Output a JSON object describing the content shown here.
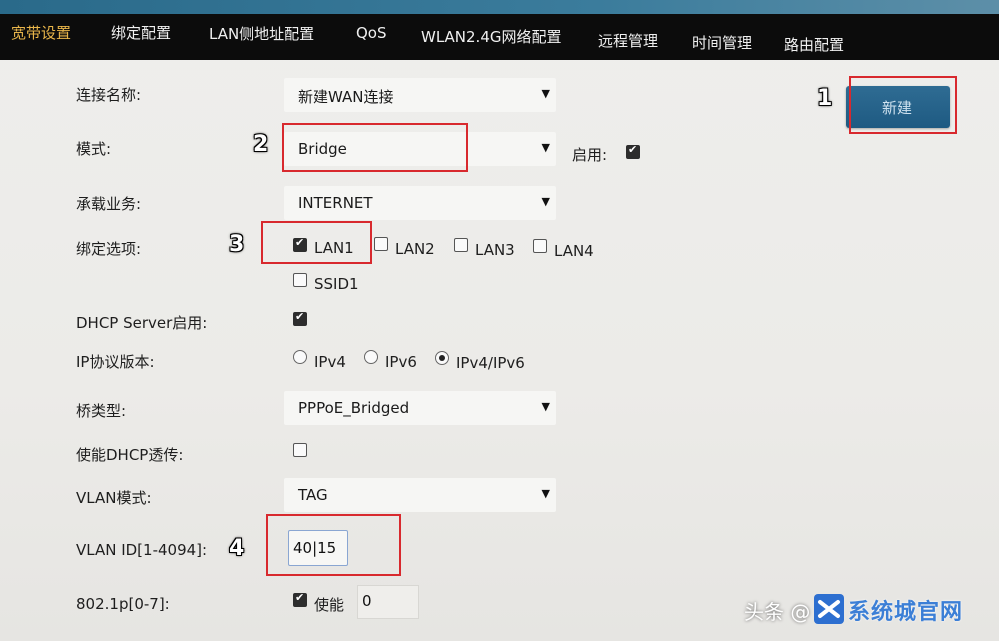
{
  "nav": {
    "items": [
      {
        "label": "宽带设置",
        "active": true
      },
      {
        "label": "绑定配置"
      },
      {
        "label": "LAN侧地址配置"
      },
      {
        "label": "QoS"
      },
      {
        "label": "WLAN2.4G网络配置"
      },
      {
        "label": "远程管理"
      },
      {
        "label": "时间管理"
      },
      {
        "label": "路由配置"
      }
    ]
  },
  "new_button": {
    "label": "新建"
  },
  "form": {
    "connection_name": {
      "label": "连接名称:",
      "value": "新建WAN连接"
    },
    "mode": {
      "label": "模式:",
      "value": "Bridge",
      "enable_label": "启用:",
      "enable_checked": true
    },
    "service": {
      "label": "承载业务:",
      "value": "INTERNET"
    },
    "binding": {
      "label": "绑定选项:",
      "options": [
        {
          "label": "LAN1",
          "checked": true
        },
        {
          "label": "LAN2",
          "checked": false
        },
        {
          "label": "LAN3",
          "checked": false
        },
        {
          "label": "LAN4",
          "checked": false
        },
        {
          "label": "SSID1",
          "checked": false
        }
      ]
    },
    "dhcp_server": {
      "label": "DHCP Server启用:",
      "checked": true
    },
    "ip_version": {
      "label": "IP协议版本:",
      "options": [
        {
          "label": "IPv4",
          "selected": false
        },
        {
          "label": "IPv6",
          "selected": false
        },
        {
          "label": "IPv4/IPv6",
          "selected": true
        }
      ]
    },
    "bridge_type": {
      "label": "桥类型:",
      "value": "PPPoE_Bridged"
    },
    "dhcp_passthrough": {
      "label": "使能DHCP透传:",
      "checked": false
    },
    "vlan_mode": {
      "label": "VLAN模式:",
      "value": "TAG"
    },
    "vlan_id": {
      "label": "VLAN ID[1-4094]:",
      "value": "40|15"
    },
    "priority": {
      "label": "802.1p[0-7]:",
      "enable_label": "使能",
      "enable_checked": true,
      "value": "0"
    }
  },
  "annotations": [
    "1",
    "2",
    "3",
    "4"
  ],
  "watermark": {
    "prefix": "头条 @",
    "name": "系统城官网"
  },
  "colors": {
    "nav_active": "#e8b54a",
    "highlight": "#d8292e",
    "button": "#1e5a82"
  }
}
